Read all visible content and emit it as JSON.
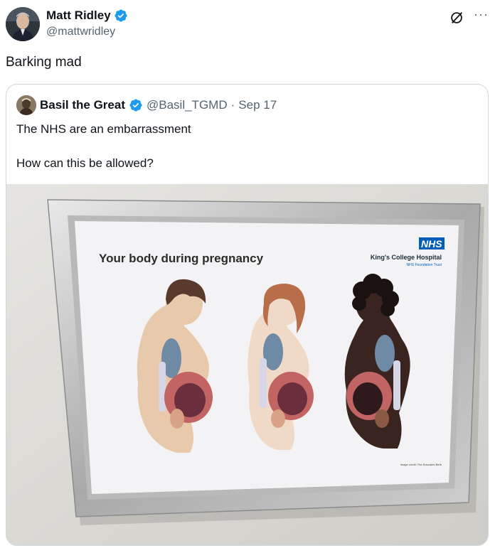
{
  "author": {
    "name": "Matt Ridley",
    "handle": "@mattwridley"
  },
  "actions": {
    "grok_icon": "grok-icon",
    "more_label": "···"
  },
  "tweet": {
    "text": "Barking mad"
  },
  "quoted": {
    "name": "Basil the Great",
    "handle": "@Basil_TGMD",
    "separator": "·",
    "date": "Sep 17",
    "line1": "The NHS are an embarrassment",
    "line2": "How can this be allowed?"
  },
  "poster": {
    "title": "Your body during pregnancy",
    "logo": "NHS",
    "hospital": "King's College Hospital",
    "trust": "NHS Foundation Trust",
    "credit": "Image credit: The Educated Birth"
  },
  "colors": {
    "verified": "#1d9bf0",
    "nhs_blue": "#005eb8",
    "handle_gray": "#536471"
  }
}
